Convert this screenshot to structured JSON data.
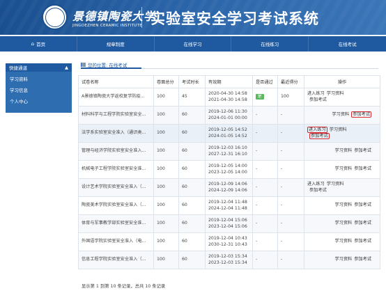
{
  "header": {
    "school_cn": "景德镇陶瓷大学",
    "school_en": "JINGDEZHEN CERAMIC INSTITUTE",
    "system_title": "实验室安全学习考试系统"
  },
  "nav": [
    {
      "label": "首页",
      "icon": "home-icon"
    },
    {
      "label": "规章制度"
    },
    {
      "label": "在线学习"
    },
    {
      "label": "在线练习"
    },
    {
      "label": "在线考试"
    }
  ],
  "sidebar": {
    "title": "快捷通道",
    "items": [
      {
        "label": "学习资料"
      },
      {
        "label": "学习信息"
      },
      {
        "label": "个人中心"
      }
    ]
  },
  "breadcrumb": {
    "text": "您的位置: 在线考试"
  },
  "table": {
    "headers": [
      "试卷名称",
      "卷面总分",
      "考试时长",
      "有效期",
      "是否通过",
      "最近得分",
      "操作"
    ],
    "rows": [
      {
        "name": "A景德镇陶瓷大学返校复学防疫...",
        "total": "100",
        "duration": "45",
        "valid_from": "2020-04-30 14:58",
        "valid_to": "2021-04-30 14:58",
        "passed": "是",
        "score": "100",
        "ops": [
          "进入练习",
          "学习资料",
          "参加考试"
        ],
        "layout": "left"
      },
      {
        "name": "材料科学与工程学院实验室安全...",
        "total": "100",
        "duration": "60",
        "valid_from": "2019-12-06 11:30",
        "valid_to": "2024-01-01 00:00",
        "passed": "-",
        "score": "-",
        "ops": [
          "学习资料",
          "参加考试"
        ],
        "layout": "right",
        "boxed": [
          1
        ]
      },
      {
        "name": "法学系实验室安全准入（通识类...",
        "total": "100",
        "duration": "60",
        "valid_from": "2019-12-05 14:52",
        "valid_to": "2024-01-05 14:52",
        "passed": "-",
        "score": "-",
        "ops": [
          "进入练习",
          "学习资料",
          "参加考试"
        ],
        "layout": "left",
        "boxed": [
          0,
          2
        ],
        "highlight": true
      },
      {
        "name": "管理与经济学院实验室安全准入...",
        "total": "100",
        "duration": "60",
        "valid_from": "2019-12-03 16:10",
        "valid_to": "2027-12-31 16:10",
        "passed": "-",
        "score": "-",
        "ops": [
          "学习资料",
          "参加考试"
        ],
        "layout": "right"
      },
      {
        "name": "机械电子工程学院实验室安全准...",
        "total": "100",
        "duration": "60",
        "valid_from": "2019-12-05 14:00",
        "valid_to": "2023-12-05 14:00",
        "passed": "-",
        "score": "-",
        "ops": [
          "学习资料",
          "参加考试"
        ],
        "layout": "right"
      },
      {
        "name": "设计艺术学院实验室安全准入（...",
        "total": "100",
        "duration": "60",
        "valid_from": "2019-12-09 14:06",
        "valid_to": "2024-12-09 14:06",
        "passed": "-",
        "score": "-",
        "ops": [
          "进入练习",
          "学习资料",
          "参加考试"
        ],
        "layout": "left"
      },
      {
        "name": "陶瓷美术学院实验室安全准入（...",
        "total": "100",
        "duration": "60",
        "valid_from": "2019-12-04 11:48",
        "valid_to": "2024-12-04 11:48",
        "passed": "-",
        "score": "-",
        "ops": [
          "学习资料",
          "参加考试"
        ],
        "layout": "right"
      },
      {
        "name": "体育与军事教学部实验室安全准...",
        "total": "100",
        "duration": "60",
        "valid_from": "2019-12-04 15:06",
        "valid_to": "2023-12-04 15:06",
        "passed": "-",
        "score": "-",
        "ops": [
          "学习资料",
          "参加考试"
        ],
        "layout": "right"
      },
      {
        "name": "外国语学院实验室安全准入（电...",
        "total": "100",
        "duration": "60",
        "valid_from": "2019-12-04 10:43",
        "valid_to": "2030-12-31 10:43",
        "passed": "-",
        "score": "-",
        "ops": [
          "学习资料",
          "参加考试"
        ],
        "layout": "right"
      },
      {
        "name": "信息工程学院实验室安全准入（...",
        "total": "100",
        "duration": "60",
        "valid_from": "2019-12-03 15:34",
        "valid_to": "2023-12-03 15:34",
        "passed": "-",
        "score": "-",
        "ops": [
          "学习资料",
          "参加考试"
        ],
        "layout": "right"
      }
    ]
  },
  "footer": {
    "text": "显示第 1 到第 10 条记录，总共 10 条记录"
  },
  "colors": {
    "brand": "#1f5aa0",
    "pass_badge": "#5cb85c",
    "highlight_box": "#d9272e"
  }
}
